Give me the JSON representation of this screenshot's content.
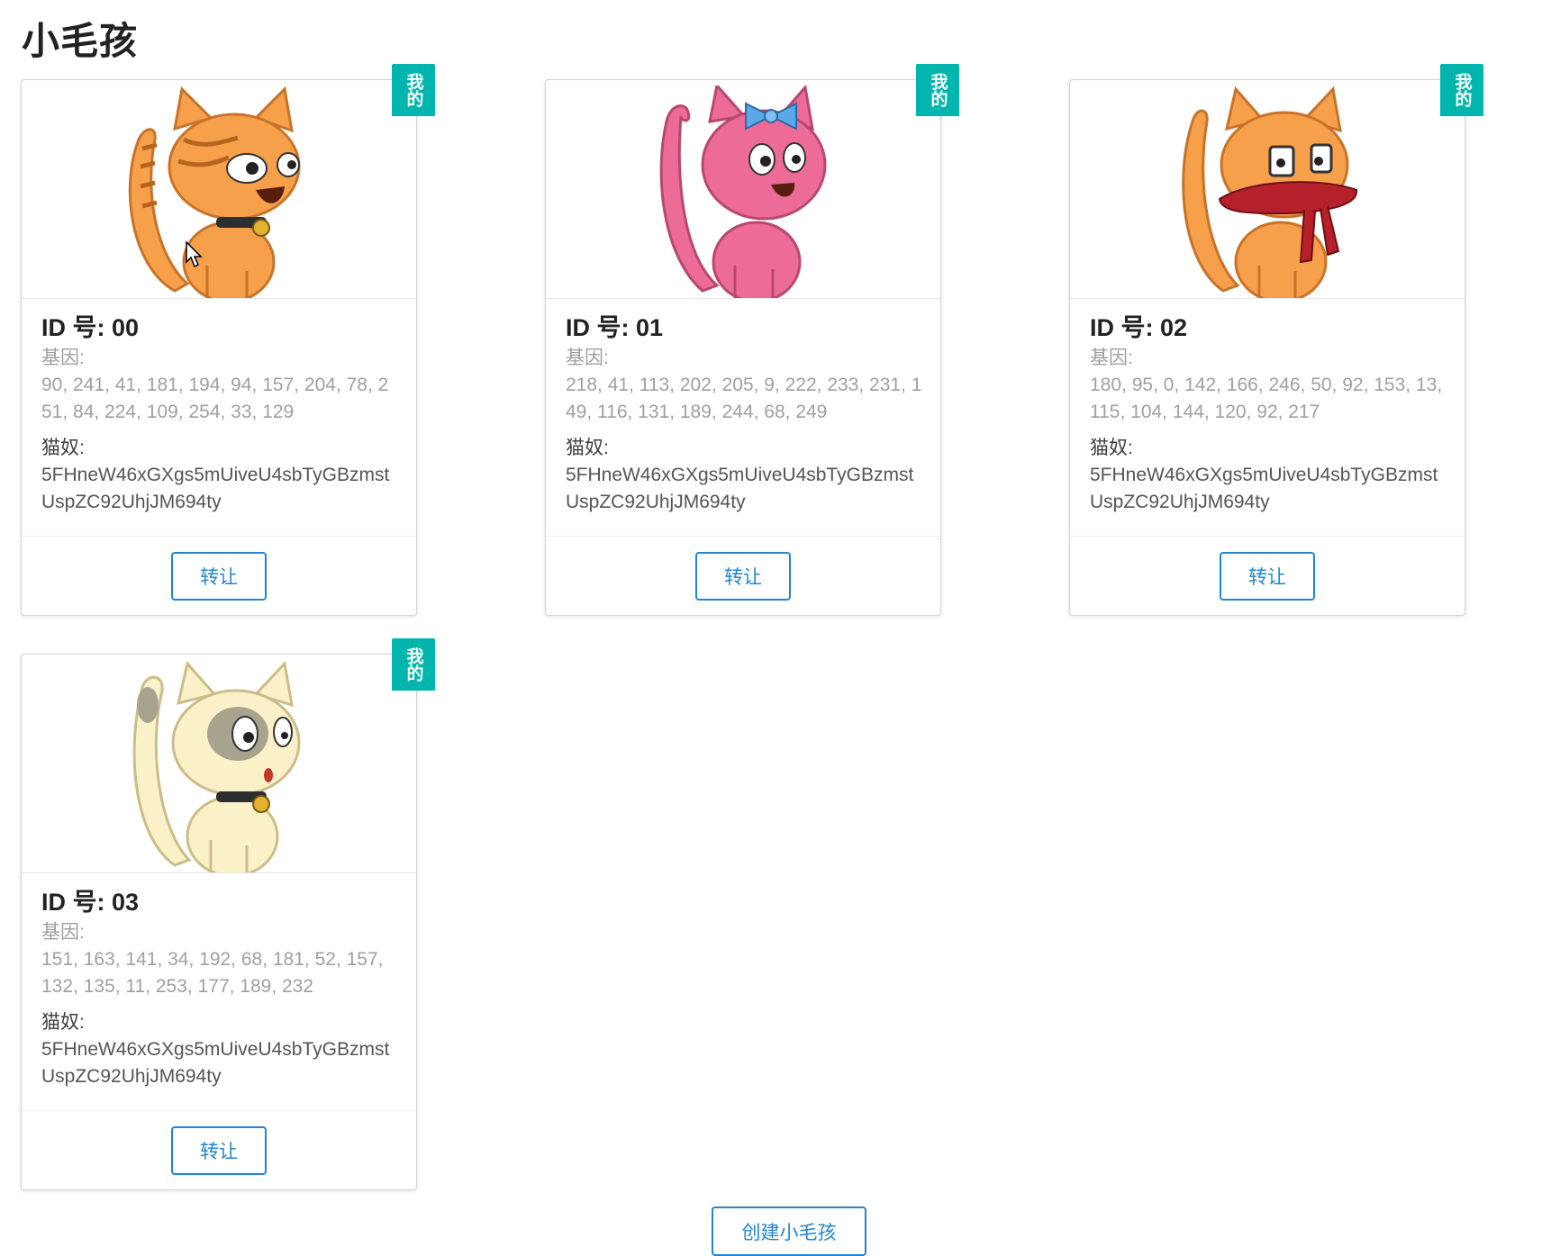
{
  "page": {
    "title": "小毛孩"
  },
  "labels": {
    "ribbon": "我的",
    "genes_label": "基因:",
    "owner_label": "猫奴:",
    "transfer_button": "转让",
    "create_button": "创建小毛孩"
  },
  "kitties": [
    {
      "id_text": "ID 号: 00",
      "genes": "90, 241, 41, 181, 194, 94, 157, 204, 78, 251, 84, 224, 109, 254, 33, 129",
      "owner": "5FHneW46xGXgs5mUiveU4sbTyGBzmstUspZC92UhjJM694ty",
      "image": "orange-tabby-cat-with-collar-icon"
    },
    {
      "id_text": "ID 号: 01",
      "genes": "218, 41, 113, 202, 205, 9, 222, 233, 231, 149, 116, 131, 189, 244, 68, 249",
      "owner": "5FHneW46xGXgs5mUiveU4sbTyGBzmstUspZC92UhjJM694ty",
      "image": "pink-cat-with-blue-bow-icon"
    },
    {
      "id_text": "ID 号: 02",
      "genes": "180, 95, 0, 142, 166, 246, 50, 92, 153, 13, 115, 104, 144, 120, 92, 217",
      "owner": "5FHneW46xGXgs5mUiveU4sbTyGBzmstUspZC92UhjJM694ty",
      "image": "orange-cat-with-red-scarf-icon"
    },
    {
      "id_text": "ID 号: 03",
      "genes": "151, 163, 141, 34, 192, 68, 181, 52, 157, 132, 135, 11, 253, 177, 189, 232",
      "owner": "5FHneW46xGXgs5mUiveU4sbTyGBzmstUspZC92UhjJM694ty",
      "image": "cream-cat-with-eye-patch-icon"
    }
  ],
  "colors": {
    "ribbon": "#00b5ad",
    "button": "#2185d0",
    "orange_cat": "#f7a04b",
    "pink_cat": "#ec6b97",
    "cream_cat": "#faf1c8",
    "scarf": "#b5202a",
    "bow": "#5aa9e6"
  }
}
